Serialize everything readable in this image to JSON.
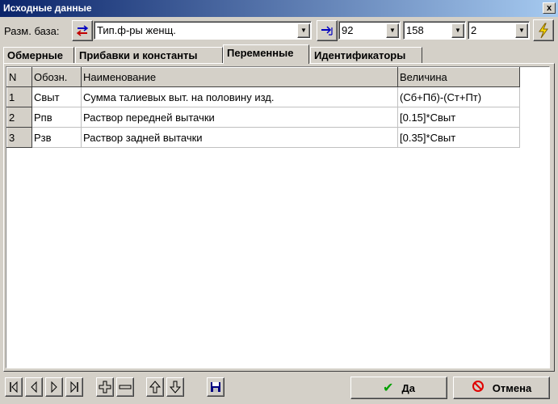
{
  "window": {
    "title": "Исходные данные",
    "close_label": "x"
  },
  "toolbar": {
    "size_base_label": "Разм. база:",
    "figure_type_value": "Тип.ф-ры женщ.",
    "size1_value": "92",
    "size2_value": "158",
    "size3_value": "2"
  },
  "tabs": [
    {
      "label": "Обмерные",
      "active": false
    },
    {
      "label": "Прибавки и константы",
      "active": false
    },
    {
      "label": "Переменные",
      "active": true
    },
    {
      "label": "Идентификаторы",
      "active": false
    }
  ],
  "table": {
    "headers": [
      "N",
      "Обозн.",
      "Наименование",
      "Величина"
    ],
    "rows": [
      [
        "1",
        "Свыт",
        "Сумма талиевых выт. на половину изд.",
        "(Сб+Пб)-(Ст+Пт)"
      ],
      [
        "2",
        "Рпв",
        "Раствор передней вытачки",
        "[0.15]*Свыт"
      ],
      [
        "3",
        "Рзв",
        "Раствор задней вытачки",
        "[0.35]*Свыт"
      ]
    ]
  },
  "buttons": {
    "ok_label": "Да",
    "cancel_label": "Отмена"
  },
  "colors": {
    "title_start": "#0a246a",
    "title_end": "#a6caf0",
    "face": "#d4d0c8",
    "ok_check": "#00a000",
    "cancel_icon": "#e00000",
    "save_icon": "#000080"
  }
}
